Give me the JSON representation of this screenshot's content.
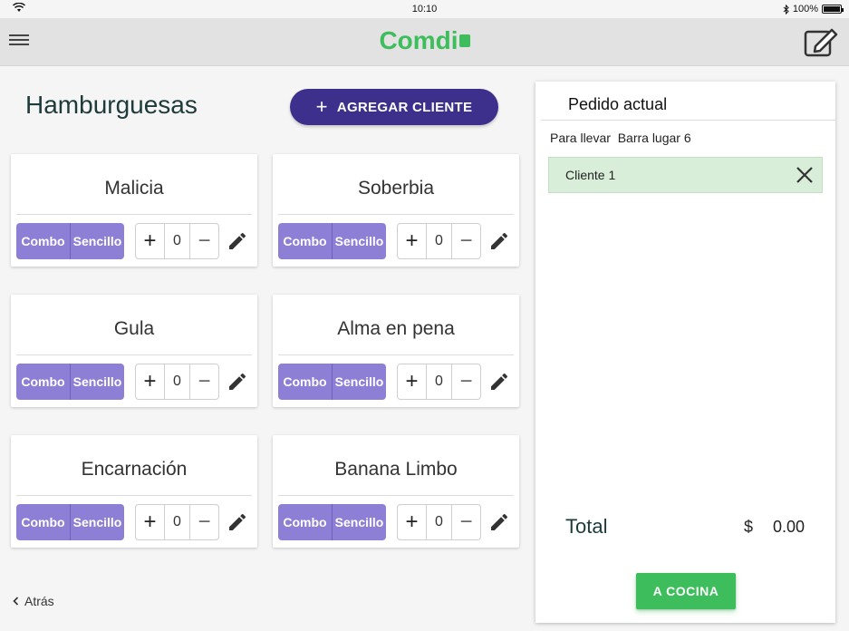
{
  "status_bar": {
    "time": "10:10",
    "battery": "100%"
  },
  "app": {
    "logo": "Comdi"
  },
  "section": {
    "title": "Hamburguesas",
    "add_client_label": "AGREGAR CLIENTE"
  },
  "products": [
    {
      "name": "Malicia",
      "combo": "Combo",
      "single": "Sencillo",
      "qty": "0"
    },
    {
      "name": "Soberbia",
      "combo": "Combo",
      "single": "Sencillo",
      "qty": "0"
    },
    {
      "name": "Gula",
      "combo": "Combo",
      "single": "Sencillo",
      "qty": "0"
    },
    {
      "name": "Alma en pena",
      "combo": "Combo",
      "single": "Sencillo",
      "qty": "0"
    },
    {
      "name": "Encarnación",
      "combo": "Combo",
      "single": "Sencillo",
      "qty": "0"
    },
    {
      "name": "Banana Limbo",
      "combo": "Combo",
      "single": "Sencillo",
      "qty": "0"
    }
  ],
  "back_label": "Atrás",
  "order": {
    "title": "Pedido actual",
    "type": "Para llevar  Barra lugar 6",
    "clients": [
      {
        "name": "Cliente 1"
      }
    ],
    "total_label": "Total",
    "currency": "$",
    "total": "0.00",
    "send_label": "A COCINA"
  },
  "colors": {
    "brand_green": "#3dbd5b",
    "primary_purple": "#3d2f8c",
    "segment_purple": "#8e7fd6",
    "client_bg": "#d9eed9"
  },
  "icons": [
    "wifi-icon",
    "bluetooth-icon",
    "battery-icon",
    "menu-icon",
    "compose-icon",
    "plus-icon",
    "minus-icon",
    "pencil-icon",
    "chevron-left-icon",
    "close-icon"
  ]
}
